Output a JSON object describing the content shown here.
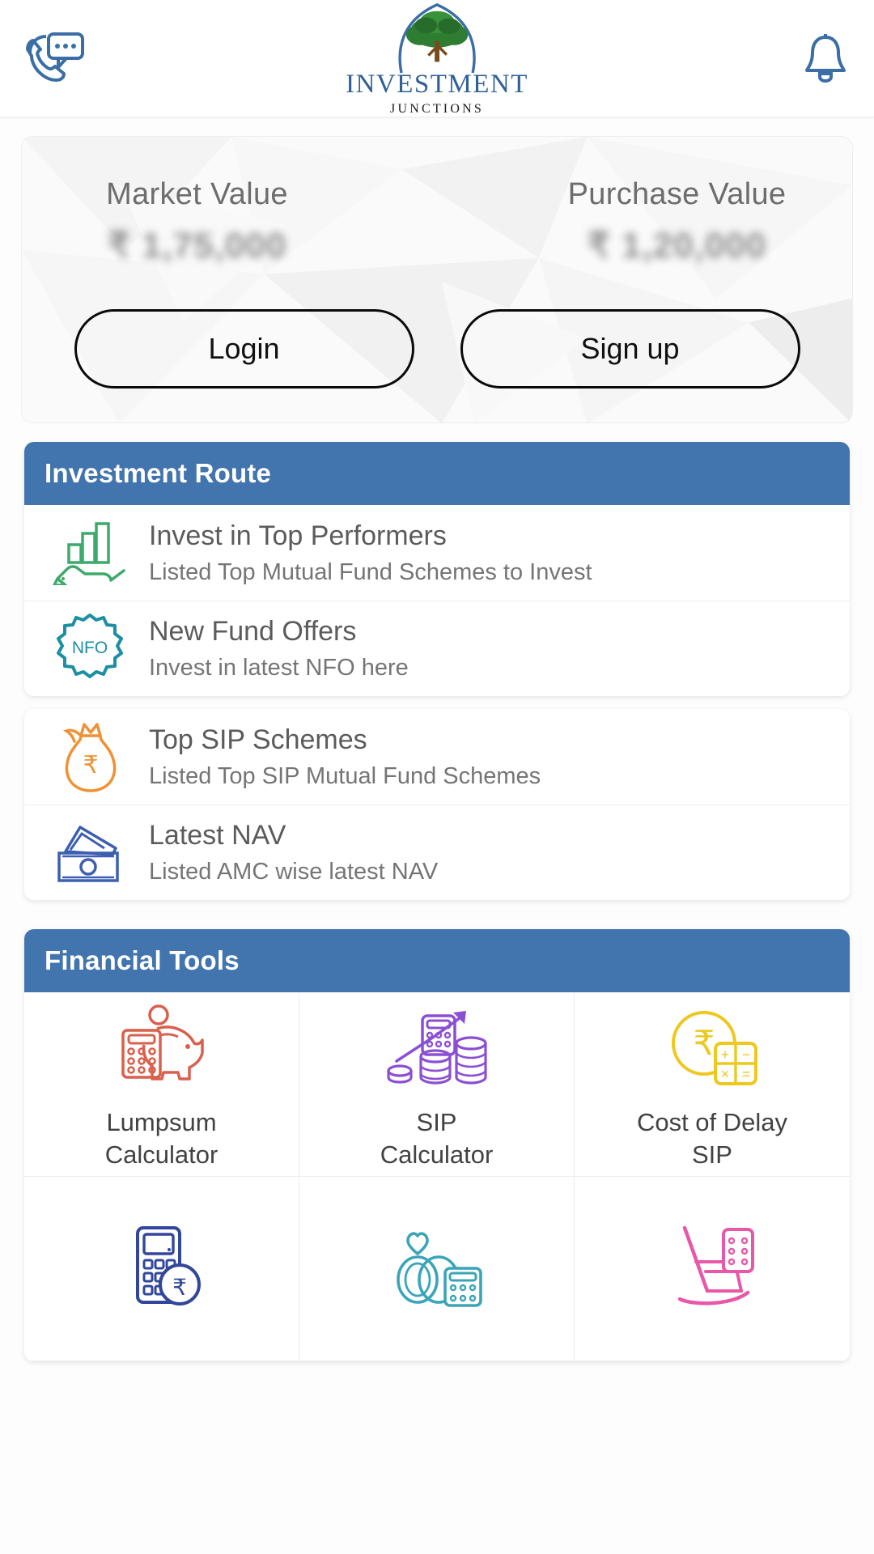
{
  "header": {
    "support_icon": "phone-chat-icon",
    "notification_icon": "bell-icon",
    "logo": {
      "mark": "tree-logo-icon",
      "name": "INVESTMENT",
      "sub": "JUNCTIONS"
    }
  },
  "hero": {
    "market": {
      "label": "Market Value",
      "amount": "₹ 1,75,000",
      "blurred": true
    },
    "purchase": {
      "label": "Purchase Value",
      "amount": "₹ 1,20,000",
      "blurred": true
    },
    "login_label": "Login",
    "signup_label": "Sign up"
  },
  "investment_route": {
    "title": "Investment Route",
    "items": [
      {
        "icon": "hand-bar-chart-icon",
        "color": "#3caa6b",
        "title": "Invest in Top Performers",
        "sub": "Listed Top Mutual Fund Schemes to Invest"
      },
      {
        "icon": "nfo-badge-icon",
        "color": "#1b8fa3",
        "title": "New Fund Offers",
        "sub": "Invest in latest NFO here"
      }
    ]
  },
  "schemes_card": {
    "items": [
      {
        "icon": "money-bag-rupee-icon",
        "color": "#ef9135",
        "title": "Top SIP Schemes",
        "sub": "Listed Top SIP Mutual Fund Schemes"
      },
      {
        "icon": "cash-notes-icon",
        "color": "#3c5fb0",
        "title": "Latest NAV",
        "sub": "Listed AMC wise latest NAV"
      }
    ]
  },
  "financial_tools": {
    "title": "Financial Tools",
    "tools": [
      {
        "icon": "piggy-bank-calculator-icon",
        "color": "#d9604c",
        "label": "Lumpsum\nCalculator",
        "line1": "Lumpsum",
        "line2": "Calculator"
      },
      {
        "icon": "coin-stack-calculator-icon",
        "color": "#8b4fd4",
        "label": "SIP\nCalculator",
        "line1": "SIP",
        "line2": "Calculator"
      },
      {
        "icon": "rupee-coin-calculator-icon",
        "color": "#edc81f",
        "label": "Cost of Delay\nSIP",
        "line1": "Cost of Delay",
        "line2": "SIP"
      },
      {
        "icon": "calculator-rupee-coin-icon",
        "color": "#32479b",
        "label": "",
        "line1": "",
        "line2": ""
      },
      {
        "icon": "wedding-rings-calculator-icon",
        "color": "#3aa5b8",
        "label": "",
        "line1": "",
        "line2": ""
      },
      {
        "icon": "rocking-chair-calculator-icon",
        "color": "#e858a8",
        "label": "",
        "line1": "",
        "line2": ""
      }
    ]
  },
  "colors": {
    "brand_blue": "#4274ad",
    "logo_blue": "#2f6096",
    "tree_green": "#2f7d32"
  }
}
